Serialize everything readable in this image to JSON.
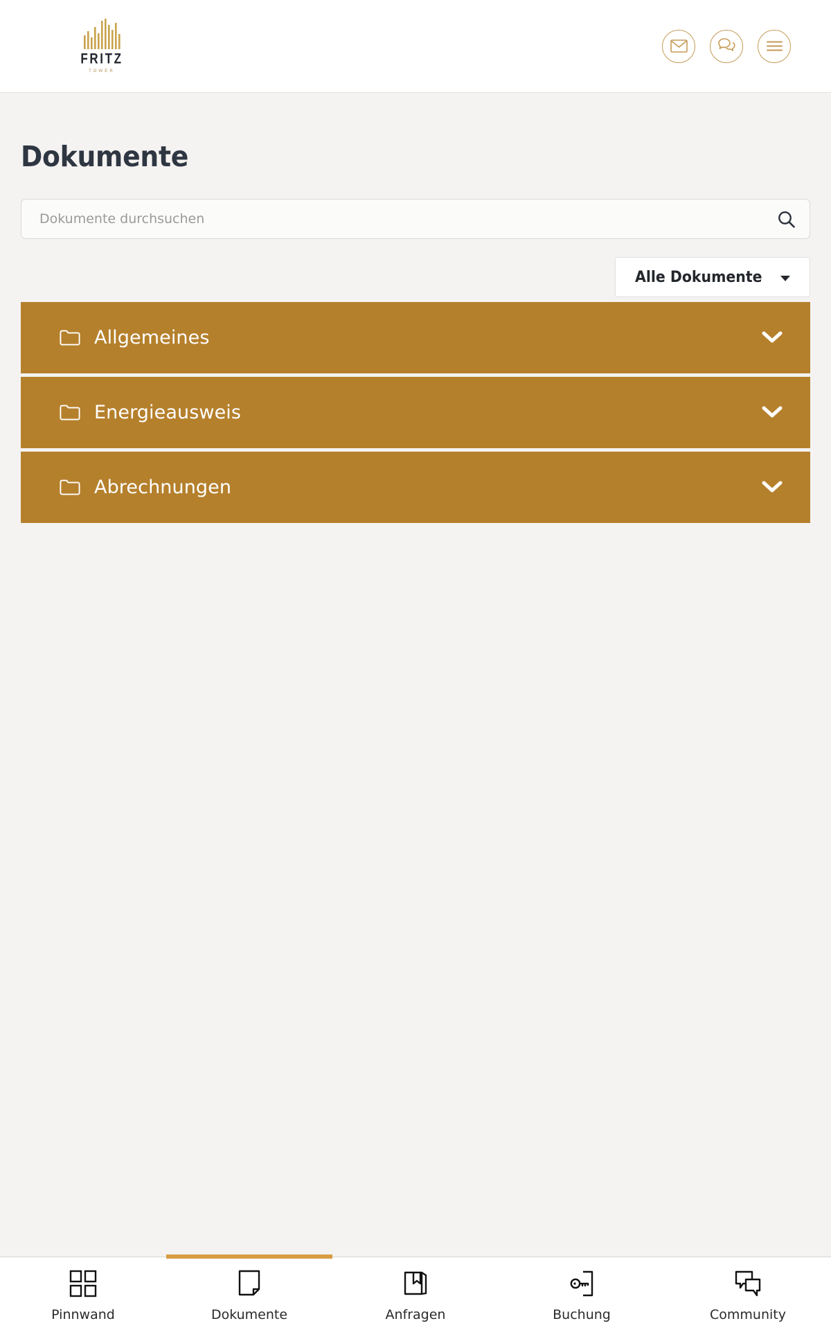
{
  "header": {
    "brand": {
      "name": "FRITZ",
      "sub": "TOWER",
      "logo_icon": "skyline-bars-icon"
    },
    "actions": [
      {
        "name": "mail-icon",
        "label": "Nachrichten"
      },
      {
        "name": "chat-icon",
        "label": "Chat"
      },
      {
        "name": "hamburger-menu-icon",
        "label": "Menü"
      }
    ]
  },
  "main": {
    "title": "Dokumente",
    "search": {
      "placeholder": "Dokumente durchsuchen",
      "value": "",
      "icon": "search-icon"
    },
    "filter": {
      "label": "Alle Dokumente",
      "icon": "chevron-down-icon"
    },
    "folders": [
      {
        "label": "Allgemeines",
        "icon": "folder-icon",
        "chevron": "chevron-down-icon"
      },
      {
        "label": "Energieausweis",
        "icon": "folder-icon",
        "chevron": "chevron-down-icon"
      },
      {
        "label": "Abrechnungen",
        "icon": "folder-icon",
        "chevron": "chevron-down-icon"
      }
    ]
  },
  "bottom_nav": {
    "active_index": 1,
    "items": [
      {
        "label": "Pinnwand",
        "icon": "grid-icon"
      },
      {
        "label": "Dokumente",
        "icon": "document-page-icon"
      },
      {
        "label": "Anfragen",
        "icon": "book-bookmark-icon"
      },
      {
        "label": "Buchung",
        "icon": "key-door-icon"
      },
      {
        "label": "Community",
        "icon": "chat-bubbles-icon"
      }
    ]
  },
  "colors": {
    "accent_bronze": "#b5802c",
    "accent_gold": "#d79c42",
    "brand_gold": "#c59a55",
    "page_bg": "#f4f3f1",
    "title_navy": "#2e3642"
  }
}
